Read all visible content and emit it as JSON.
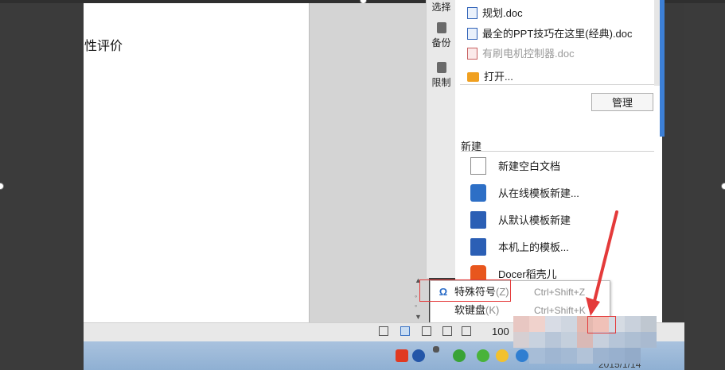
{
  "document": {
    "text": "性评价"
  },
  "side_strip": {
    "items": [
      {
        "label": "选择"
      },
      {
        "label": "备份"
      },
      {
        "label": "限制"
      }
    ]
  },
  "recent_files": [
    {
      "name": "规划.doc",
      "state": "normal"
    },
    {
      "name": "最全的PPT技巧在这里(经典).doc",
      "state": "normal"
    },
    {
      "name": "有刷电机控制器.doc",
      "state": "disabled"
    }
  ],
  "open_label": "打开...",
  "manage_label": "管理",
  "new_section": {
    "title": "新建",
    "items": [
      {
        "label": "新建空白文档",
        "icon": "blank-document-icon"
      },
      {
        "label": "从在线模板新建...",
        "icon": "online-template-icon"
      },
      {
        "label": "从默认模板新建",
        "icon": "default-template-icon"
      },
      {
        "label": "本机上的模板...",
        "icon": "local-template-icon"
      },
      {
        "label": "Docer稻壳儿",
        "icon": "docer-icon"
      }
    ]
  },
  "popup_menu": {
    "items": [
      {
        "symbol": "Ω",
        "label": "特殊符号",
        "key": "(Z)",
        "shortcut": "Ctrl+Shift+Z"
      },
      {
        "symbol": "",
        "label": "软键盘",
        "key": "(K)",
        "shortcut": "Ctrl+Shift+K"
      }
    ]
  },
  "statusbar": {
    "zoom": "100"
  },
  "taskbar": {
    "date": "2015/1/14"
  },
  "colors": {
    "annotation_red": "#e43a3a",
    "accent_blue": "#3c7fd6"
  }
}
